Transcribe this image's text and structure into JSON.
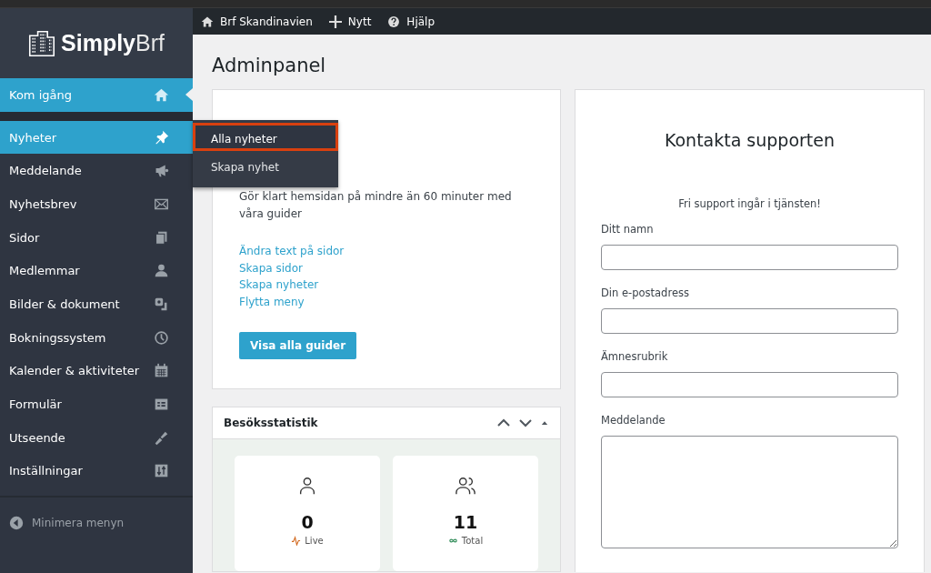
{
  "brand": {
    "name_bold": "Simply",
    "name_light": "Brf"
  },
  "top_bar": [
    {
      "kind": "home",
      "label": "Brf Skandinavien"
    },
    {
      "kind": "plus",
      "label": "Nytt"
    },
    {
      "kind": "help",
      "label": "Hjälp"
    }
  ],
  "sidebar": {
    "items": [
      {
        "label": "Kom igång",
        "kind": "home",
        "selected": true,
        "expanded": false
      },
      {
        "label": "Nyheter",
        "kind": "pin",
        "selected": false,
        "expanded": true,
        "children": [
          {
            "label": "Alla nyheter",
            "selected": true
          },
          {
            "label": "Skapa nyhet",
            "selected": false
          }
        ]
      },
      {
        "label": "Meddelande",
        "kind": "megaphone",
        "selected": false,
        "expanded": false
      },
      {
        "label": "Nyhetsbrev",
        "kind": "mail",
        "selected": false,
        "expanded": false
      },
      {
        "label": "Sidor",
        "kind": "pages",
        "selected": false,
        "expanded": false
      },
      {
        "label": "Medlemmar",
        "kind": "person",
        "selected": false,
        "expanded": false
      },
      {
        "label": "Bilder & dokument",
        "kind": "media",
        "selected": false,
        "expanded": false
      },
      {
        "label": "Bokningssystem",
        "kind": "clock",
        "selected": false,
        "expanded": false
      },
      {
        "label": "Kalender & aktiviteter",
        "kind": "calendar",
        "selected": false,
        "expanded": false
      },
      {
        "label": "Formulär",
        "kind": "form",
        "selected": false,
        "expanded": false
      },
      {
        "label": "Utseende",
        "kind": "brush",
        "selected": false,
        "expanded": false
      },
      {
        "label": "Inställningar",
        "kind": "settings",
        "selected": false,
        "expanded": false
      }
    ],
    "collapse": "Minimera menyn"
  },
  "page_title": "Adminpanel",
  "guide_card": {
    "text": "Gör klart hemsidan på mindre än 60 minuter med våra guider",
    "links": [
      "Ändra text på sidor",
      "Skapa sidor",
      "Skapa nyheter",
      "Flytta meny"
    ],
    "button": "Visa alla guider"
  },
  "stats_card": {
    "title": "Besöksstatistik",
    "stats": [
      {
        "kind": "live",
        "value": "0",
        "label": "Live"
      },
      {
        "kind": "total",
        "value": "11",
        "label": "Total"
      }
    ]
  },
  "support_card": {
    "title": "Kontakta supporten",
    "subtitle": "Fri support ingår i tjänsten!",
    "fields": [
      {
        "kind": "input",
        "label": "Ditt namn"
      },
      {
        "kind": "input",
        "label": "Din e-postadress"
      },
      {
        "kind": "input",
        "label": "Ämnesrubrik"
      },
      {
        "kind": "textarea",
        "label": "Meddelande"
      }
    ]
  }
}
